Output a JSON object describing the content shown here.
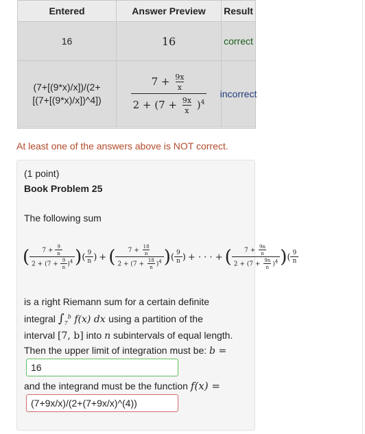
{
  "results_table": {
    "headers": [
      "Entered",
      "Answer Preview",
      "Result"
    ],
    "rows": [
      {
        "entered": "16",
        "preview": "16",
        "result": "correct"
      },
      {
        "entered_line1": "(7+[(9*x)/x])/(2+",
        "entered_line2": "[(7+[(9*x)/x])^4])",
        "preview_num_const": "7 +",
        "preview_frac_num": "9x",
        "preview_frac_den": "x",
        "preview_den_prefix": "2 + (7 +",
        "preview_den_frac_num": "9x",
        "preview_den_frac_den": "x",
        "preview_den_close": ")",
        "preview_den_power": "4",
        "result": "incorrect"
      }
    ]
  },
  "feedback_message": "At least one of the answers above is NOT correct.",
  "problem": {
    "points": "(1 point)",
    "title": "Book Problem 25",
    "intro": "The following sum",
    "sum_terms": [
      {
        "seven": "7",
        "plus": "+",
        "num": "9",
        "den": "n",
        "two": "2",
        "power": "4",
        "factor_num": "9",
        "factor_den": "n"
      },
      {
        "seven": "7",
        "plus": "+",
        "num": "18",
        "den": "n",
        "two": "2",
        "power": "4",
        "factor_num": "9",
        "factor_den": "n"
      },
      {
        "seven": "7",
        "plus": "+",
        "num": "9n",
        "den": "n",
        "two": "2",
        "power": "4",
        "factor_num": "9",
        "factor_den": "n"
      }
    ],
    "sum_plus": "+",
    "sum_ellipsis": "+ · · · +",
    "desc_line1": "is a right Riemann sum for a certain definite",
    "desc_line2_pre": "integral",
    "integral_lower": "7",
    "integral_upper": "b",
    "integral_body": "f(x) dx",
    "desc_line2_post": "using a partition of the",
    "desc_line3_pre": "interval",
    "interval": "[7, b]",
    "desc_line3_mid": "into",
    "desc_line3_n": "n",
    "desc_line3_post": "subintervals of equal length.",
    "desc_line4": "Then the upper limit of integration must be:",
    "b_label": "b =",
    "answer_b": "16",
    "integrand_label": "and the integrand must be the function",
    "fx_label": "f(x) =",
    "answer_fx": "(7+9x/x)/(2+(7+9x/x)^(4))"
  }
}
